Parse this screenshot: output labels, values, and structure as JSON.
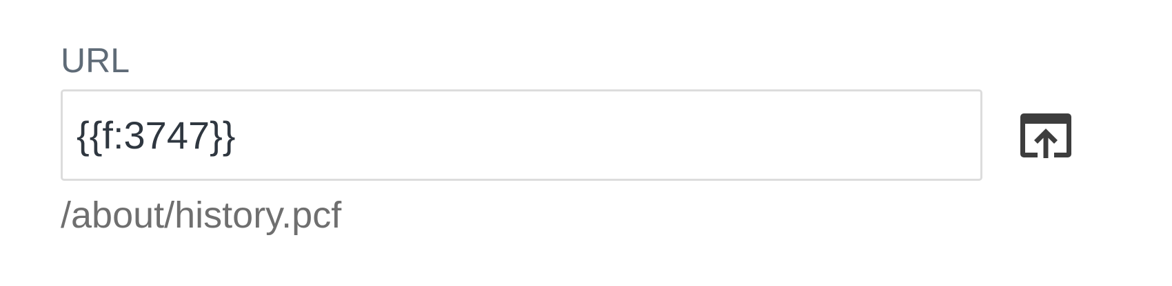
{
  "url_field": {
    "label": "URL",
    "value": "{{f:3747}}",
    "path": "/about/history.pcf",
    "button_icon": "upload-box-icon"
  },
  "colors": {
    "label": "#5f6b77",
    "input_text": "#2f3740",
    "input_border": "#dcdcdc",
    "path_text": "#6f6f6f",
    "icon": "#3d3d3d"
  }
}
